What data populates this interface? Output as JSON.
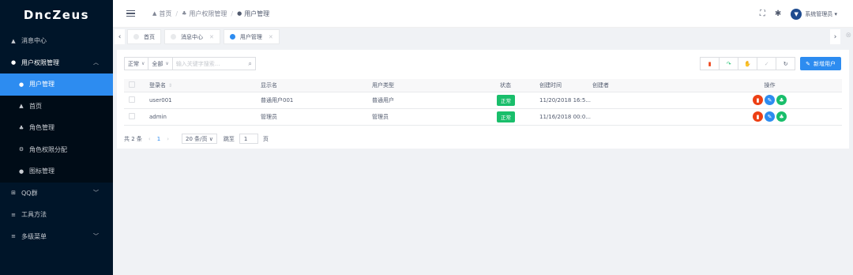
{
  "app": {
    "logo": "DncZeus"
  },
  "sidebar": {
    "items": [
      {
        "label": "消息中心",
        "icon": "bell-icon"
      },
      {
        "label": "用户权限管理",
        "icon": "group-icon"
      },
      {
        "label": "QQ群",
        "icon": "grid-icon"
      },
      {
        "label": "工具方法",
        "icon": "menu-icon"
      },
      {
        "label": "多级菜单",
        "icon": "menu-icon"
      }
    ],
    "submenu": [
      {
        "label": "用户管理",
        "icon": "user-icon"
      },
      {
        "label": "首页",
        "icon": "home-icon"
      },
      {
        "label": "角色管理",
        "icon": "roles-icon"
      },
      {
        "label": "角色权限分配",
        "icon": "settings-icon"
      },
      {
        "label": "图标管理",
        "icon": "icons-icon"
      }
    ]
  },
  "header": {
    "breadcrumb": [
      "首页",
      "用户权限管理",
      "用户管理"
    ],
    "user": "系统管理员"
  },
  "tabs": [
    {
      "label": "首页"
    },
    {
      "label": "消息中心"
    },
    {
      "label": "用户管理"
    }
  ],
  "toolbar": {
    "status_select": "正常",
    "type_select": "全部",
    "search_placeholder": "输入关键字搜索...",
    "add_user": "新增用户"
  },
  "table": {
    "columns": [
      "登录名",
      "显示名",
      "用户类型",
      "状态",
      "创建时间",
      "创建者",
      "操作"
    ],
    "rows": [
      {
        "login": "user001",
        "display": "普通用户001",
        "type": "普通用户",
        "status": "正常",
        "created": "11/20/2018 16:5...",
        "creator": ""
      },
      {
        "login": "admin",
        "display": "管理员",
        "type": "管理员",
        "status": "正常",
        "created": "11/16/2018 00:0...",
        "creator": ""
      }
    ]
  },
  "pager": {
    "total": "共 2 条",
    "current": "1",
    "page_size": "20 条/页",
    "jump_label": "跳至",
    "jump_value": "1",
    "page_unit": "页"
  },
  "colors": {
    "sidebar": "#001529",
    "accent": "#2d8cf0",
    "success": "#19be6b",
    "danger": "#ed4014"
  }
}
